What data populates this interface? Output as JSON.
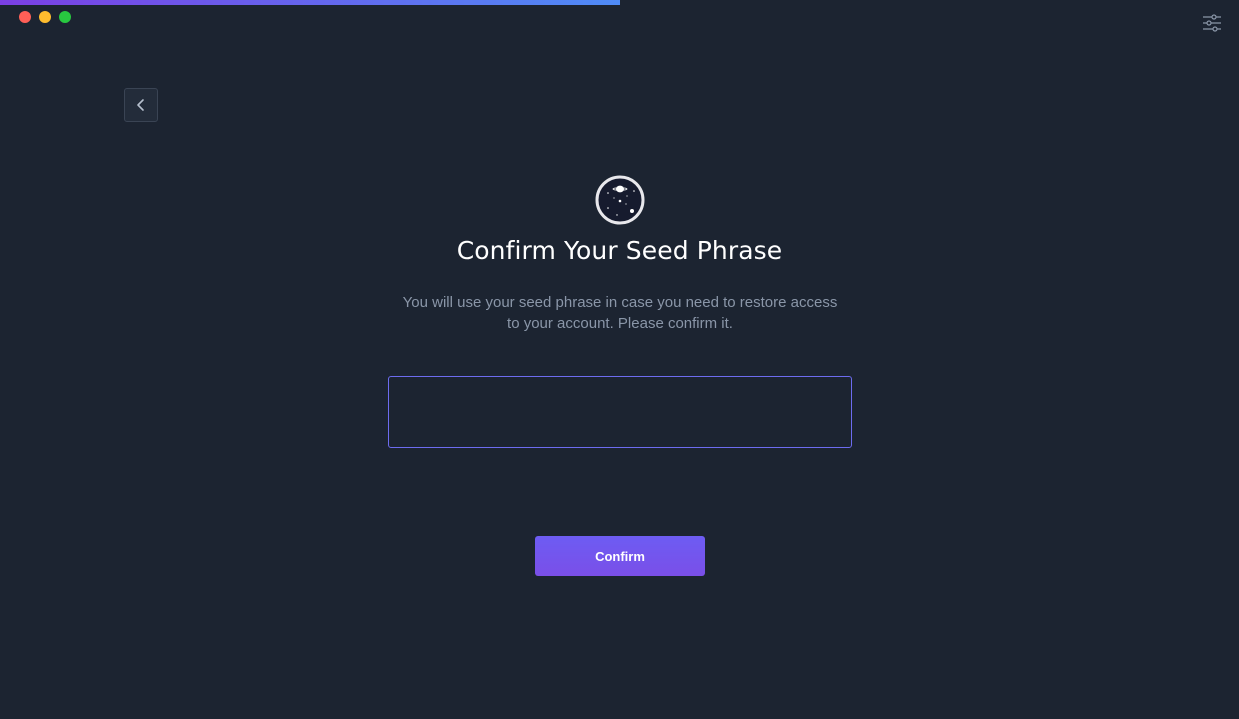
{
  "window": {
    "controls": [
      "close",
      "minimize",
      "maximize"
    ]
  },
  "progress": {
    "value_fraction": 0.5
  },
  "header": {
    "settings_icon": "sliders-icon",
    "back_icon": "chevron-left-icon"
  },
  "main": {
    "logo_icon": "planet-logo-icon",
    "title": "Confirm Your Seed Phrase",
    "subtitle": "You will use your seed phrase in case you need to restore access to your account. Please confirm it.",
    "seed_input": {
      "value": "",
      "placeholder": ""
    },
    "confirm_label": "Confirm"
  },
  "colors": {
    "background": "#1c2431",
    "accent": "#6d5cf3",
    "input_border": "#6d6cf0",
    "progress_start": "#7b3fe4",
    "progress_end": "#4f8cf7"
  }
}
